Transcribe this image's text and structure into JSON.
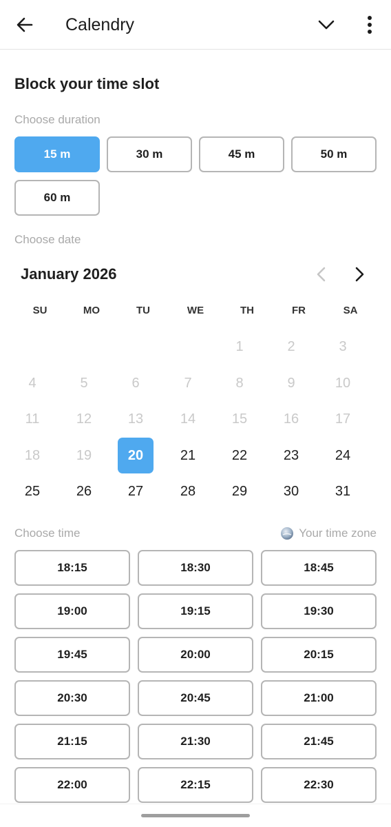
{
  "appbar": {
    "title": "Calendry"
  },
  "section_title": "Block your time slot",
  "duration": {
    "caption": "Choose duration",
    "options": [
      "15 m",
      "30 m",
      "45 m",
      "50 m",
      "60 m"
    ],
    "selected": "15 m"
  },
  "date": {
    "caption": "Choose date",
    "month_label": "January 2026",
    "weekdays": [
      "SU",
      "MO",
      "TU",
      "WE",
      "TH",
      "FR",
      "SA"
    ],
    "days_disabled": [
      "1",
      "2",
      "3",
      "4",
      "5",
      "6",
      "7",
      "8",
      "9",
      "10",
      "11",
      "12",
      "13",
      "14",
      "15",
      "16",
      "17",
      "18",
      "19"
    ],
    "day_selected": "20",
    "days_enabled": [
      "21",
      "22",
      "23",
      "24",
      "25",
      "26",
      "27",
      "28",
      "29",
      "30",
      "31"
    ]
  },
  "time": {
    "caption": "Choose time",
    "timezone_label": "Your time zone",
    "slots": [
      "18:15",
      "18:30",
      "18:45",
      "19:00",
      "19:15",
      "19:30",
      "19:45",
      "20:00",
      "20:15",
      "20:30",
      "20:45",
      "21:00",
      "21:15",
      "21:30",
      "21:45",
      "22:00",
      "22:15",
      "22:30"
    ]
  },
  "colors": {
    "accent": "#4fa9ef",
    "border": "#b5b5b5",
    "muted_text": "#a9a9a9",
    "disabled_day": "#c9c9c9"
  },
  "icons": {
    "back": "arrow-left-icon",
    "expand": "chevron-down-icon",
    "more": "more-vertical-icon",
    "prev_month": "chevron-left-icon",
    "next_month": "chevron-right-icon",
    "timezone": "globe-icon"
  }
}
